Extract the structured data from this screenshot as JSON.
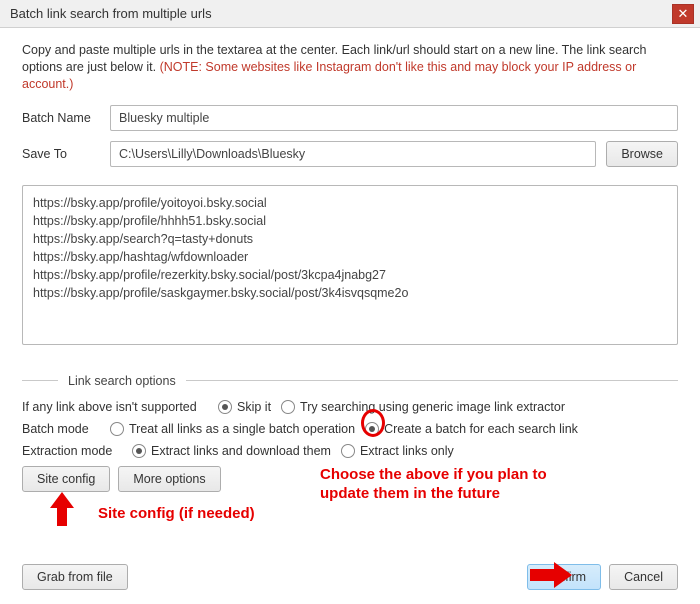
{
  "window": {
    "title": "Batch link search from multiple urls"
  },
  "intro": {
    "text": "Copy and paste multiple urls in the textarea at the center. Each link/url should start on a new line. The link search options are just below it. ",
    "warning": "(NOTE: Some websites like Instagram don't like this and may block your IP address or account.)"
  },
  "fields": {
    "batch_name_label": "Batch Name",
    "batch_name_value": "Bluesky multiple",
    "save_to_label": "Save To",
    "save_to_value": "C:\\Users\\Lilly\\Downloads\\Bluesky",
    "browse_label": "Browse"
  },
  "urls_text": "https://bsky.app/profile/yoitoyoi.bsky.social\nhttps://bsky.app/profile/hhhh51.bsky.social\nhttps://bsky.app/search?q=tasty+donuts\nhttps://bsky.app/hashtag/wfdownloader\nhttps://bsky.app/profile/rezerkity.bsky.social/post/3kcpa4jnabg27\nhttps://bsky.app/profile/saskgaymer.bsky.social/post/3k4isvqsqme2o",
  "options": {
    "section_title": "Link search options",
    "unsupported_label": "If any link above isn't supported",
    "unsupported_skip": "Skip it",
    "unsupported_generic": "Try searching using generic image link extractor",
    "batch_mode_label": "Batch mode",
    "batch_mode_single": "Treat all links as a single batch operation",
    "batch_mode_each": "Create a batch for each search link",
    "extraction_label": "Extraction mode",
    "extraction_download": "Extract links and download them",
    "extraction_only": "Extract links only"
  },
  "buttons": {
    "site_config": "Site config",
    "more_options": "More options",
    "grab_from_file": "Grab from file",
    "confirm": "Confirm",
    "cancel": "Cancel"
  },
  "annotations": {
    "batch_hint_line1": "Choose the above if you plan to",
    "batch_hint_line2": "update them in the future",
    "site_config_hint": "Site config (if needed)"
  },
  "colors": {
    "warning": "#c0392b",
    "annotation": "#e60000",
    "primary_button_bg": "#c3e3fb"
  }
}
